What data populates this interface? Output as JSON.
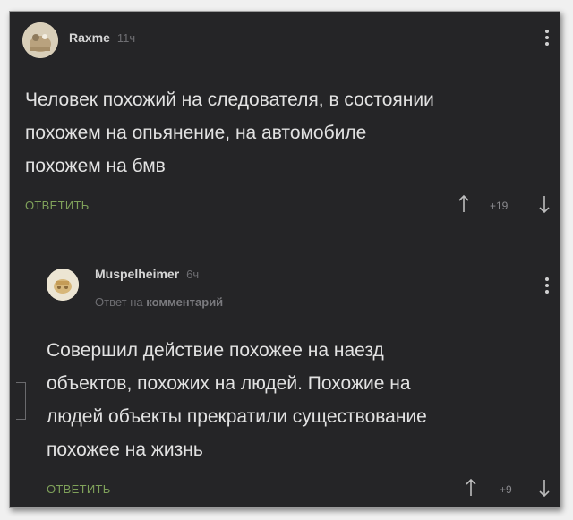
{
  "comment": {
    "username": "Raxme",
    "time": "11ч",
    "text": "Человек похожий на следователя, в состоянии\nпохожем на опьянение, на автомобиле\nпохожем на бмв",
    "reply_label": "ОТВЕТИТЬ",
    "rating": "+19",
    "avatar_icon": "avatar-image"
  },
  "reply_comment": {
    "username": "Muspelheimer",
    "time": "6ч",
    "reply_to_prefix": "Ответ на",
    "reply_to_link": "комментарий",
    "text": "Совершил действие похожее на наезд\nобъектов, похожих на людей. Похожие на\nлюдей объекты прекратили существование\nпохожее на жизнь",
    "reply_label": "ОТВЕТИТЬ",
    "rating": "+9",
    "avatar_icon": "avatar-image"
  },
  "colors": {
    "background": "#252527",
    "text": "#e2e2e2",
    "reply_green": "#7fa15a",
    "muted": "#6e6e72"
  }
}
